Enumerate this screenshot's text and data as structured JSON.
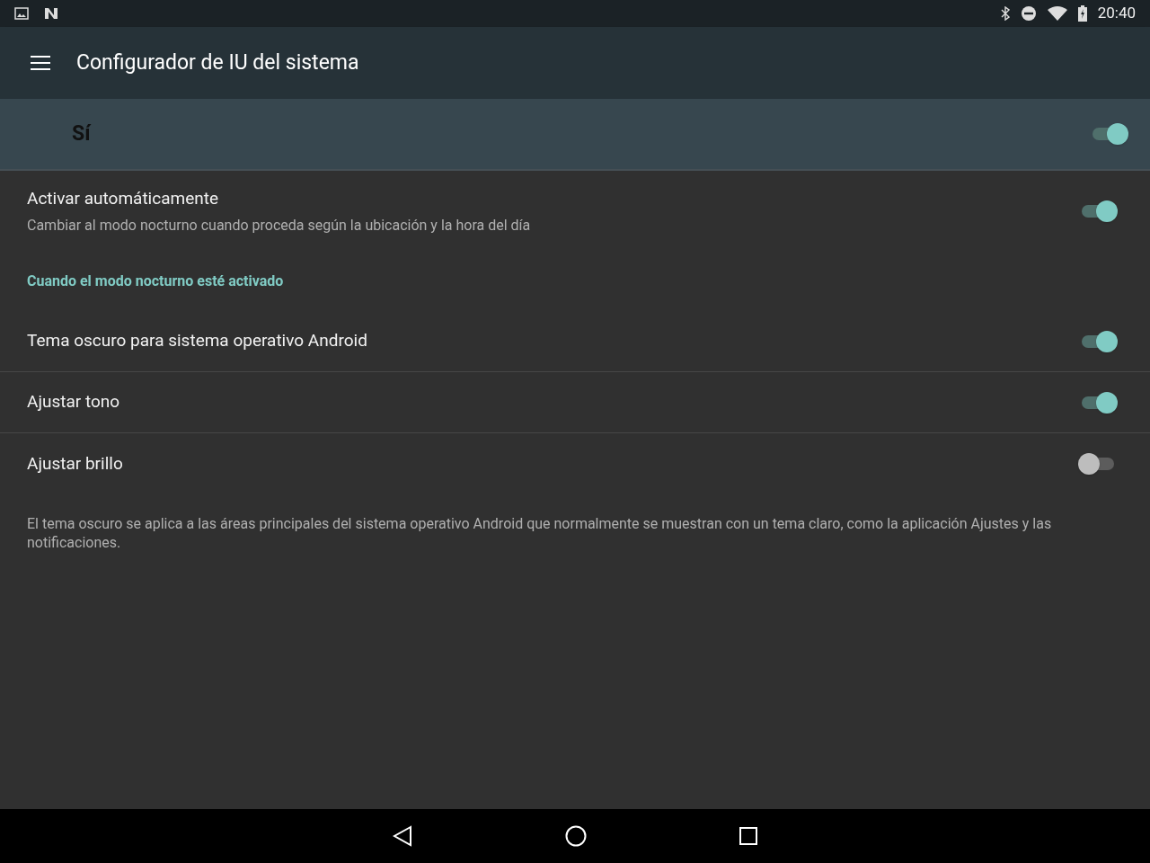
{
  "status_bar": {
    "time": "20:40"
  },
  "toolbar": {
    "title": "Configurador de IU del sistema"
  },
  "master_switch": {
    "label": "Sí",
    "on": true
  },
  "items": [
    {
      "kind": "toggle",
      "title": "Activar automáticamente",
      "summary": "Cambiar al modo nocturno cuando proceda según la ubicación y la hora del día",
      "on": true,
      "divider": false
    },
    {
      "kind": "category",
      "title": "Cuando el modo nocturno esté activado"
    },
    {
      "kind": "toggle",
      "title": "Tema oscuro para sistema operativo Android",
      "on": true,
      "divider": true
    },
    {
      "kind": "toggle",
      "title": "Ajustar tono",
      "on": true,
      "divider": true
    },
    {
      "kind": "toggle",
      "title": "Ajustar brillo",
      "on": false,
      "divider": false
    },
    {
      "kind": "footer",
      "title": "El tema oscuro se aplica a las áreas principales del sistema operativo Android que normalmente se muestran con un tema claro, como la aplicación Ajustes y las notificaciones."
    }
  ]
}
